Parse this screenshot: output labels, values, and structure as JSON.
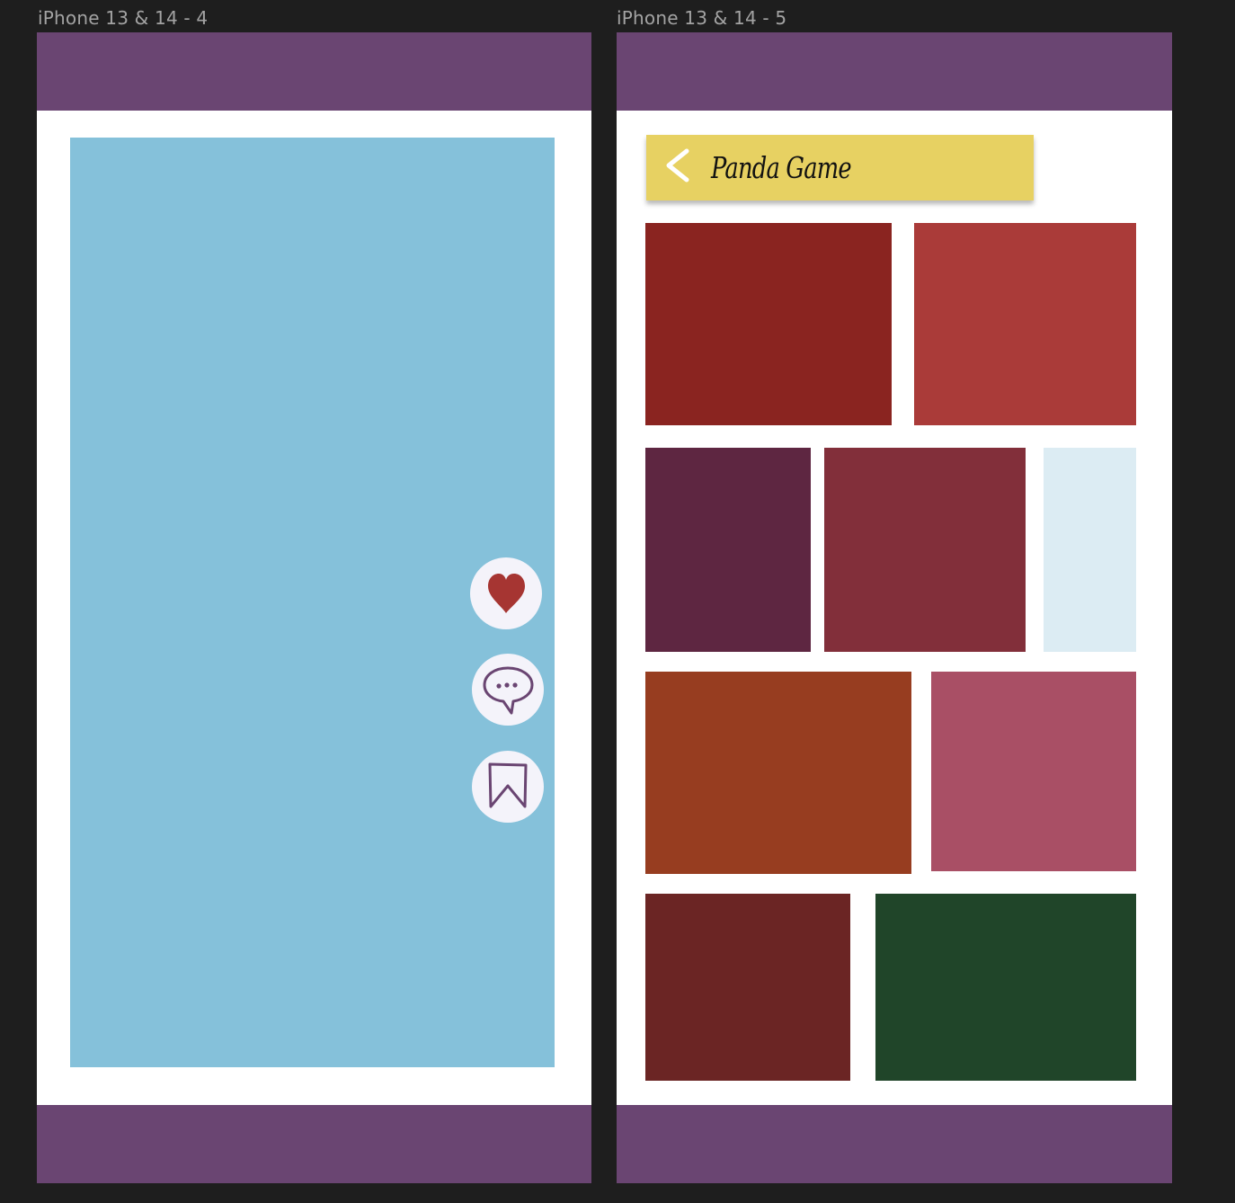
{
  "frames": [
    {
      "label": "iPhone 13 & 14 - 4"
    },
    {
      "label": "iPhone 13 & 14 - 5"
    }
  ],
  "colors": {
    "canvas": "#1e1e1e",
    "bar": "#6a4572",
    "feed_card": "#85c1da",
    "button_bg": "#f4f3fa",
    "heart": "#a63532",
    "outline_icon": "#6a4572",
    "title_bar": "#e7d162"
  },
  "frame4": {
    "actions": [
      {
        "name": "like-button",
        "icon": "heart-icon"
      },
      {
        "name": "comment-button",
        "icon": "speech-bubble-icon"
      },
      {
        "name": "bookmark-button",
        "icon": "bookmark-icon"
      }
    ]
  },
  "frame5": {
    "back_icon": "chevron-left-icon",
    "title": "Panda Game",
    "tile_colors": [
      "#8a2420",
      "#aa3b39",
      "#5e2641",
      "#822f3a",
      "#dcecf3",
      "#973d20",
      "#a94f65",
      "#6b2524",
      "#204529"
    ]
  }
}
